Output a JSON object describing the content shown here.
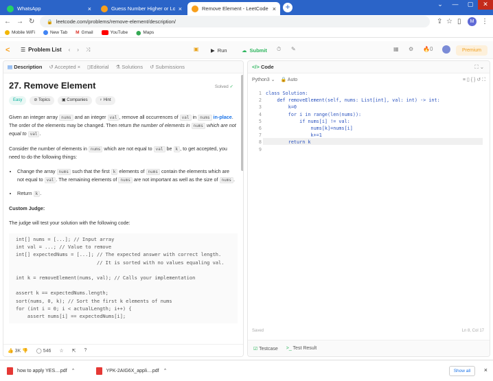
{
  "browser": {
    "tabs": [
      {
        "title": "WhatsApp",
        "color": "#25d366"
      },
      {
        "title": "Guess Number Higher or Lower -",
        "color": "#f89f1b"
      },
      {
        "title": "Remove Element - LeetCode",
        "color": "#f89f1b"
      }
    ],
    "url": "leetcode.com/problems/remove-element/description/",
    "bookmarks": [
      "Mobile WiFi",
      "New Tab",
      "Gmail",
      "YouTube",
      "Maps"
    ],
    "profile_initial": "M"
  },
  "lc": {
    "problem_list": "Problem List",
    "run": "Run",
    "submit": "Submit",
    "streak": "0",
    "premium": "Premium"
  },
  "left": {
    "tabs": [
      "Description",
      "Accepted",
      "Editorial",
      "Solutions",
      "Submissions"
    ],
    "title": "27. Remove Element",
    "solved": "Solved",
    "chips": [
      "Easy",
      "Topics",
      "Companies",
      "Hint"
    ],
    "p1a": "Given an integer array ",
    "p1b": " and an integer ",
    "p1c": ", remove all occurrences of ",
    "p1d": " in ",
    "p1e": " in-place",
    "p1f": ". The order of the elements may be changed. Then return ",
    "p1g": "the number of elements in ",
    "p1h": " which are not equal to ",
    "p2a": "Consider the number of elements in ",
    "p2b": " which are not equal to ",
    "p2c": " be ",
    "p2d": ", to get accepted, you need to do the following things:",
    "li1a": "Change the array ",
    "li1b": " such that the first ",
    "li1c": " elements of ",
    "li1d": " contain the elements which are not equal to ",
    "li1e": ". The remaining elements of ",
    "li1f": " are not important as well as the size of ",
    "li2a": "Return ",
    "custom_judge": "Custom Judge:",
    "judge_text": "The judge will test your solution with the following code:",
    "judge_code": "int[] nums = [...]; // Input array\nint val = ...; // Value to remove\nint[] expectedNums = [...]; // The expected answer with correct length.\n                            // It is sorted with no values equaling val.\n\nint k = removeElement(nums, val); // Calls your implementation\n\nassert k == expectedNums.length;\nsort(nums, 0, k); // Sort the first k elements of nums\nfor (int i = 0; i < actualLength; i++) {\n    assert nums[i] == expectedNums[i];",
    "c_nums": "nums",
    "c_val": "val",
    "c_k": "k",
    "likes": "3K",
    "comments": "546"
  },
  "right": {
    "tab": "Code",
    "lang": "Python3",
    "auto": "Auto",
    "lines": [
      "class Solution:",
      "    def removeElement(self, nums: List[int], val: int) -> int:",
      "        k=0",
      "        for i in range(len(nums)):",
      "            if nums[i] != val:",
      "                nums[k]=nums[i]",
      "                k+=1",
      "        return k",
      ""
    ],
    "saved": "Saved",
    "cursor": "Ln 8, Col 17",
    "testcase": "Testcase",
    "testresult": "Test Result"
  },
  "downloads": {
    "files": [
      "how to apply YES....pdf",
      "YPK-2AIG6X_appli....pdf"
    ],
    "show_all": "Show all"
  }
}
